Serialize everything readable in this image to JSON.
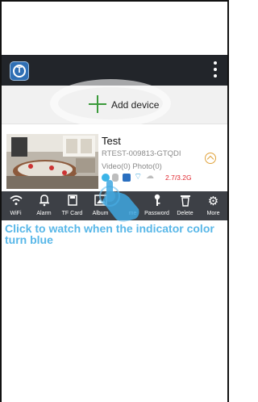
{
  "header": {
    "logo_icon": "t-logo-icon",
    "menu_icon": "more-vert-icon"
  },
  "add_device": {
    "label": "Add device"
  },
  "device": {
    "name": "Test",
    "uid": "RTEST-009813-GTQDI",
    "media": "Video(0)  Photo(0)",
    "storage": "2.7/3.2G",
    "status_colors": {
      "online": "#3cb5e8",
      "storage": "#e0262e"
    }
  },
  "toolbar": {
    "items": [
      {
        "label": "WiFi",
        "icon": "wifi-icon"
      },
      {
        "label": "Alarm",
        "icon": "bell-icon"
      },
      {
        "label": "TF Card",
        "icon": "sd-card-icon"
      },
      {
        "label": "Album",
        "icon": "image-icon"
      },
      {
        "label": "me",
        "icon": "hand-pointer-icon"
      },
      {
        "label": "Password",
        "icon": "key-icon"
      },
      {
        "label": "Delete",
        "icon": "trash-icon"
      },
      {
        "label": "More",
        "icon": "gear-icon"
      }
    ]
  },
  "hint": {
    "text": "Click to watch when the indicator color turn blue"
  }
}
